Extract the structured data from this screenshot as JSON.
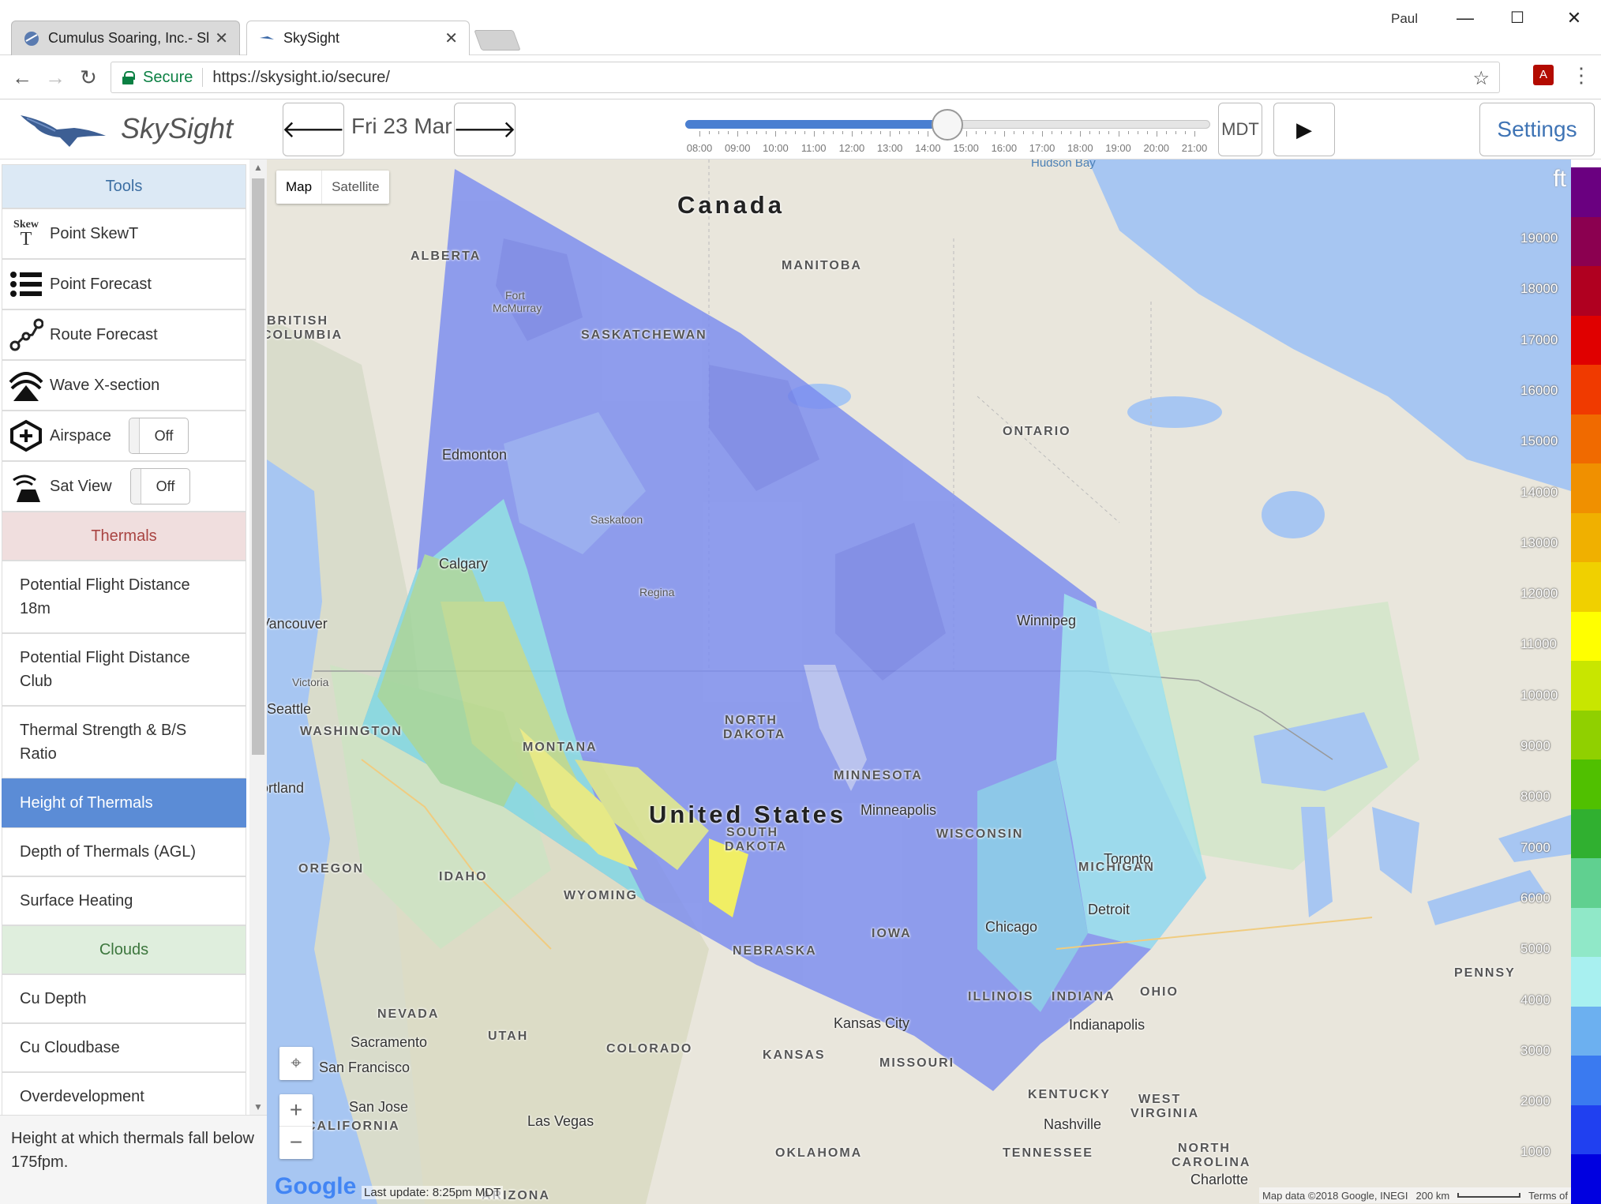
{
  "browser": {
    "tabs": [
      {
        "title": "Cumulus Soaring, Inc.- Sk",
        "active": false
      },
      {
        "title": "SkySight",
        "active": true
      }
    ],
    "profile": "Paul",
    "secure_label": "Secure",
    "url": "https://skysight.io/secure/"
  },
  "header": {
    "app_title": "SkySight",
    "date": "Fri 23 Mar",
    "timezone": "MDT",
    "settings": "Settings",
    "time_ticks": [
      "08:00",
      "09:00",
      "10:00",
      "11:00",
      "12:00",
      "13:00",
      "14:00",
      "15:00",
      "16:00",
      "17:00",
      "18:00",
      "19:00",
      "20:00",
      "21:00"
    ],
    "time_selected_fraction": 0.5
  },
  "sidebar": {
    "tools_header": "Tools",
    "tools": [
      {
        "label": "Point SkewT",
        "icon": "skewt-icon"
      },
      {
        "label": "Point Forecast",
        "icon": "list-icon"
      },
      {
        "label": "Route Forecast",
        "icon": "route-icon"
      },
      {
        "label": "Wave X-section",
        "icon": "wave-icon"
      },
      {
        "label": "Airspace",
        "icon": "airspace-icon",
        "toggle": "Off"
      },
      {
        "label": "Sat View",
        "icon": "satellite-icon",
        "toggle": "Off"
      }
    ],
    "skewt_icon_text": "Skew",
    "skewt_icon_letter": "T",
    "thermals_header": "Thermals",
    "thermals": [
      "Potential Flight Distance 18m",
      "Potential Flight Distance Club",
      "Thermal Strength & B/S Ratio",
      "Height of Thermals",
      "Depth of Thermals (AGL)",
      "Surface Heating"
    ],
    "active_item": "Height of Thermals",
    "clouds_header": "Clouds",
    "clouds": [
      "Cu Depth",
      "Cu Cloudbase",
      "Overdevelopment"
    ],
    "description": "Height at which thermals fall below 175fpm."
  },
  "map": {
    "type_map": "Map",
    "type_satellite": "Satellite",
    "units": "ft",
    "last_update": "Last update: 8:25pm MDT",
    "attribution": "Map data ©2018 Google, INEGI",
    "scale": "200 km",
    "terms": "Terms of",
    "google": "Google",
    "labels": {
      "hudson_bay": "Hudson Bay",
      "canada": "Canada",
      "united_states": "United States",
      "alberta": "ALBERTA",
      "british_columbia_1": "BRITISH",
      "british_columbia_2": "COLUMBIA",
      "saskatchewan": "SASKATCHEWAN",
      "manitoba": "MANITOBA",
      "ontario": "ONTARIO",
      "washington": "WASHINGTON",
      "oregon": "OREGON",
      "idaho": "IDAHO",
      "montana": "MONTANA",
      "wyoming": "WYOMING",
      "north_dakota_1": "NORTH",
      "north_dakota_2": "DAKOTA",
      "south_dakota_1": "SOUTH",
      "south_dakota_2": "DAKOTA",
      "minnesota": "MINNESOTA",
      "wisconsin": "WISCONSIN",
      "michigan": "MICHIGAN",
      "iowa": "IOWA",
      "nebraska": "NEBRASKA",
      "illinois": "ILLINOIS",
      "indiana": "INDIANA",
      "ohio": "OHIO",
      "nevada": "NEVADA",
      "utah": "UTAH",
      "colorado": "COLORADO",
      "kansas": "KANSAS",
      "missouri": "MISSOURI",
      "california": "CALIFORNIA",
      "kentucky": "KENTUCKY",
      "tennessee": "TENNESSEE",
      "oklahoma": "OKLAHOMA",
      "arizona": "ARIZONA",
      "west_virginia_1": "WEST",
      "west_virginia_2": "VIRGINIA",
      "penns": "PENNSY",
      "fort_mcmurray_1": "Fort",
      "fort_mcmurray_2": "McMurray",
      "edmonton": "Edmonton",
      "calgary": "Calgary",
      "saskatoon": "Saskatoon",
      "regina": "Regina",
      "winnipeg": "Winnipeg",
      "vancouver": "Vancouver",
      "victoria": "Victoria",
      "seattle": "Seattle",
      "portland": "Portland",
      "minneapolis": "Minneapolis",
      "toronto": "Toronto",
      "detroit": "Detroit",
      "chicago": "Chicago",
      "indianapolis": "Indianapolis",
      "kansas_city": "Kansas City",
      "sacramento": "Sacramento",
      "san_francisco": "San Francisco",
      "san_jose": "San Jose",
      "las_vegas": "Las Vegas",
      "nashville": "Nashville",
      "charlotte": "Charlotte",
      "north_carolina_1": "NORTH",
      "north_carolina_2": "CAROLINA"
    }
  },
  "legend": {
    "labels": [
      "19000",
      "18000",
      "17000",
      "16000",
      "15000",
      "14000",
      "13000",
      "12000",
      "11000",
      "10000",
      "9000",
      "8000",
      "7000",
      "6000",
      "5000",
      "4000",
      "3000",
      "2000",
      "1000"
    ],
    "colors": [
      "#6a0080",
      "#8b0050",
      "#b00020",
      "#e00000",
      "#f03a00",
      "#f06a00",
      "#f09000",
      "#f0b000",
      "#f0d000",
      "#ffff00",
      "#c8e600",
      "#90d000",
      "#50c000",
      "#30b030",
      "#60d090",
      "#90e8c8",
      "#a8f0f0",
      "#6cb0f0",
      "#3a7af0",
      "#2040f0",
      "#0000e0"
    ]
  }
}
